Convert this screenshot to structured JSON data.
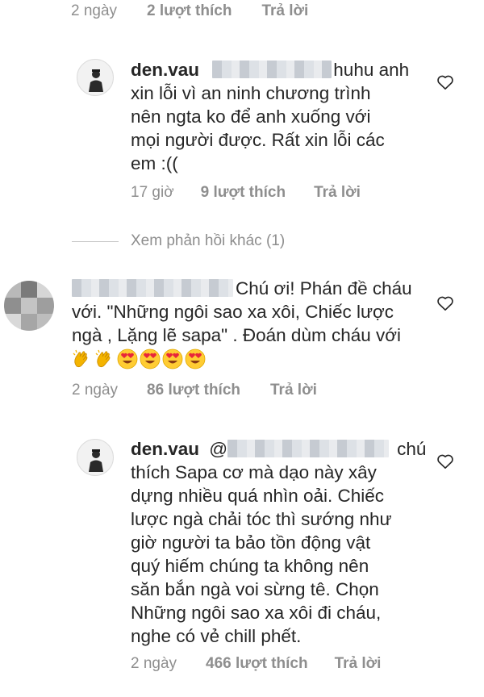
{
  "top_meta": {
    "time": "2 ngày",
    "likes": "2 lượt thích",
    "reply": "Trả lời"
  },
  "reply1": {
    "username": "den.vau",
    "text_line1": "huhu anh",
    "text_rest": [
      "xin lỗi vì an ninh chương trình",
      "nên ngta ko để anh xuống với",
      "mọi người được. Rất xin lỗi các",
      "em :(("
    ],
    "time": "17 giờ",
    "likes": "9 lượt thích",
    "reply": "Trả lời"
  },
  "view_more": {
    "label": "Xem phản hồi khác (1)"
  },
  "comment2": {
    "text_line1": "Chú ơi! Phán đề cháu",
    "text_rest": [
      "với. \"Những ngôi sao xa xôi, Chiếc lược",
      "ngà , Lặng lẽ sapa\" . Đoán dùm cháu với"
    ],
    "emojis": [
      "clapping-hands",
      "clapping-hands",
      "heart-eyes",
      "heart-eyes",
      "heart-eyes",
      "heart-eyes"
    ],
    "time": "2 ngày",
    "likes": "86 lượt thích",
    "reply": "Trả lời"
  },
  "reply2": {
    "username": "den.vau",
    "mention_prefix": "@",
    "text_line1": "chú",
    "text_rest": [
      "thích Sapa cơ mà dạo này xây",
      "dựng nhiều quá nhìn oải. Chiếc",
      "lược ngà chải tóc thì sướng như",
      "giờ người ta bảo tồn động vật",
      "quý hiếm chúng ta không nên",
      "săn bắn ngà voi sừng tê. Chọn",
      "Những ngôi sao xa xôi đi cháu,",
      "nghe có vẻ chill phết."
    ],
    "time": "2 ngày",
    "likes": "466 lượt thích",
    "reply": "Trả lời"
  },
  "icons": {
    "like": "heart-outline-icon",
    "avatar": "profile-avatar"
  },
  "colors": {
    "text": "#262626",
    "meta": "#8e8e8e",
    "redacted": "#c6cbd2"
  }
}
